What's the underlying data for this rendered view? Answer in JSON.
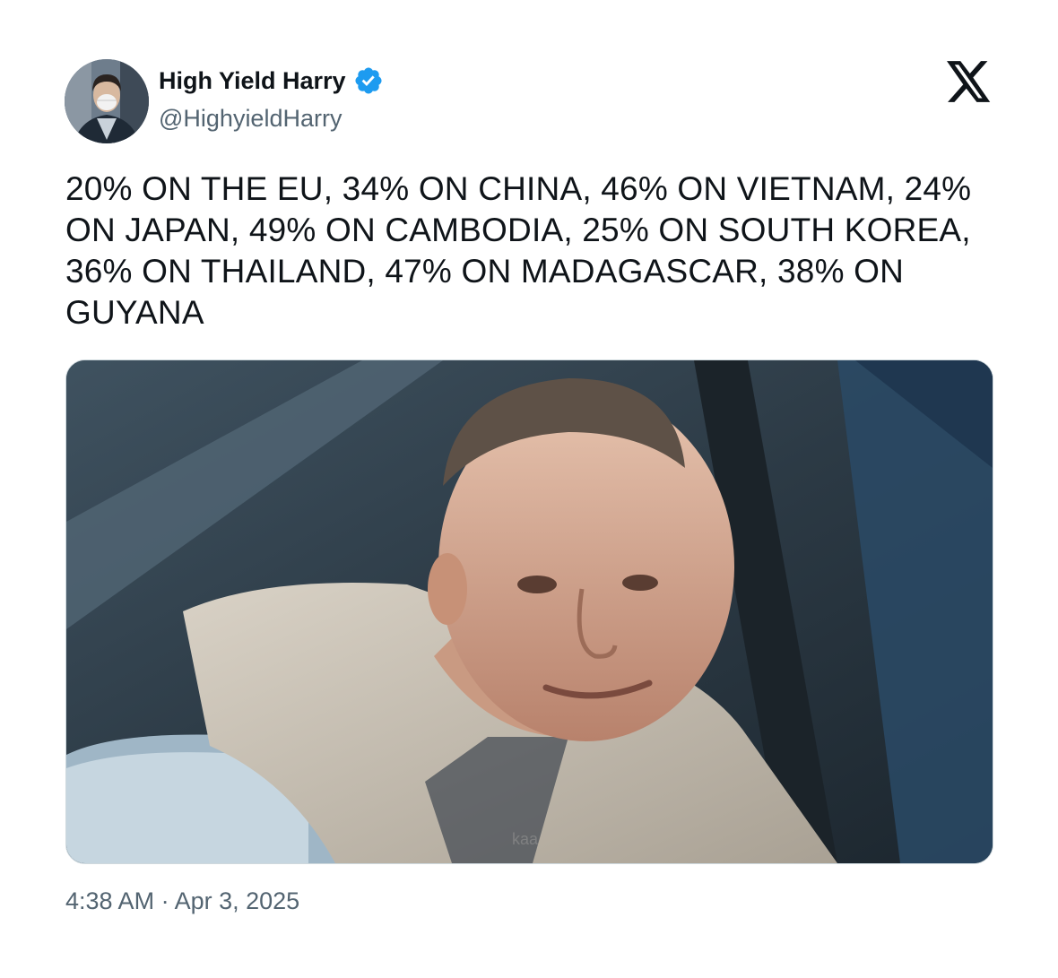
{
  "tweet": {
    "author": {
      "display_name": "High Yield Harry",
      "handle": "@HighyieldHarry",
      "verified": true,
      "avatar_icon": "avatar-photo-masked-man"
    },
    "brand_icon": "x-logo-icon",
    "text": "20% ON THE EU, 34% ON CHINA, 46% ON VIETNAM, 24% ON JAPAN, 49% ON CAMBODIA, 25% ON SOUTH KOREA, 36% ON THAILAND, 47% ON MADAGASCAR, 38% ON GUYANA",
    "media": {
      "type": "photo",
      "watermark": "kaa"
    },
    "timestamp": "4:38 AM · Apr 3, 2025"
  },
  "colors": {
    "text_primary": "#0f1419",
    "text_secondary": "#536471",
    "verified_blue": "#1d9bf0",
    "border": "#cfd9de"
  }
}
